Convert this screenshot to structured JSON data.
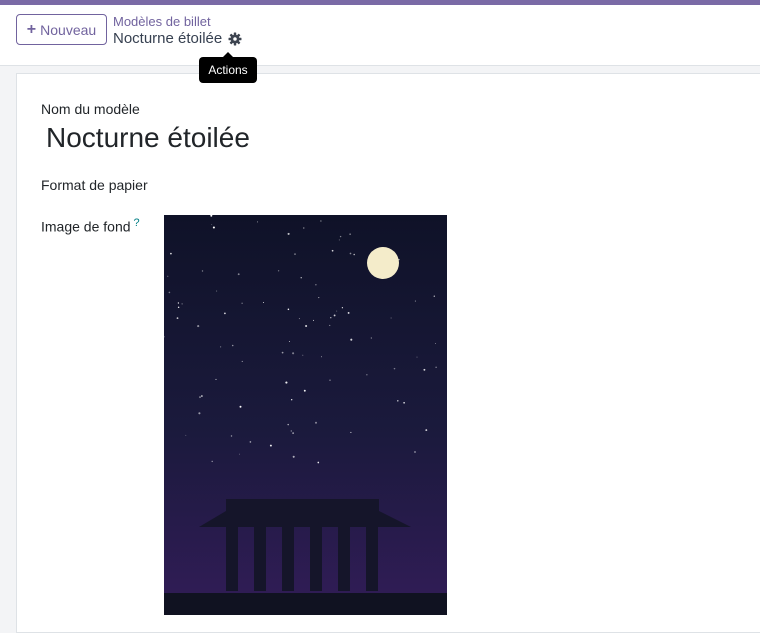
{
  "header": {
    "new_label": "Nouveau",
    "breadcrumb_parent": "Modèles de billet",
    "breadcrumb_current": "Nocturne étoilée",
    "actions_tooltip": "Actions"
  },
  "form": {
    "name_label": "Nom du modèle",
    "name_value": "Nocturne étoilée",
    "paper_format_label": "Format de papier",
    "background_label": "Image de fond",
    "help_mark": "?"
  },
  "colors": {
    "brand": "#71639e",
    "topbar": "#7a6aa6",
    "sky_top": "#0f1228",
    "sky_bottom": "#321c58"
  },
  "icons": {
    "new_button": "plus-icon",
    "actions": "gear-icon"
  }
}
